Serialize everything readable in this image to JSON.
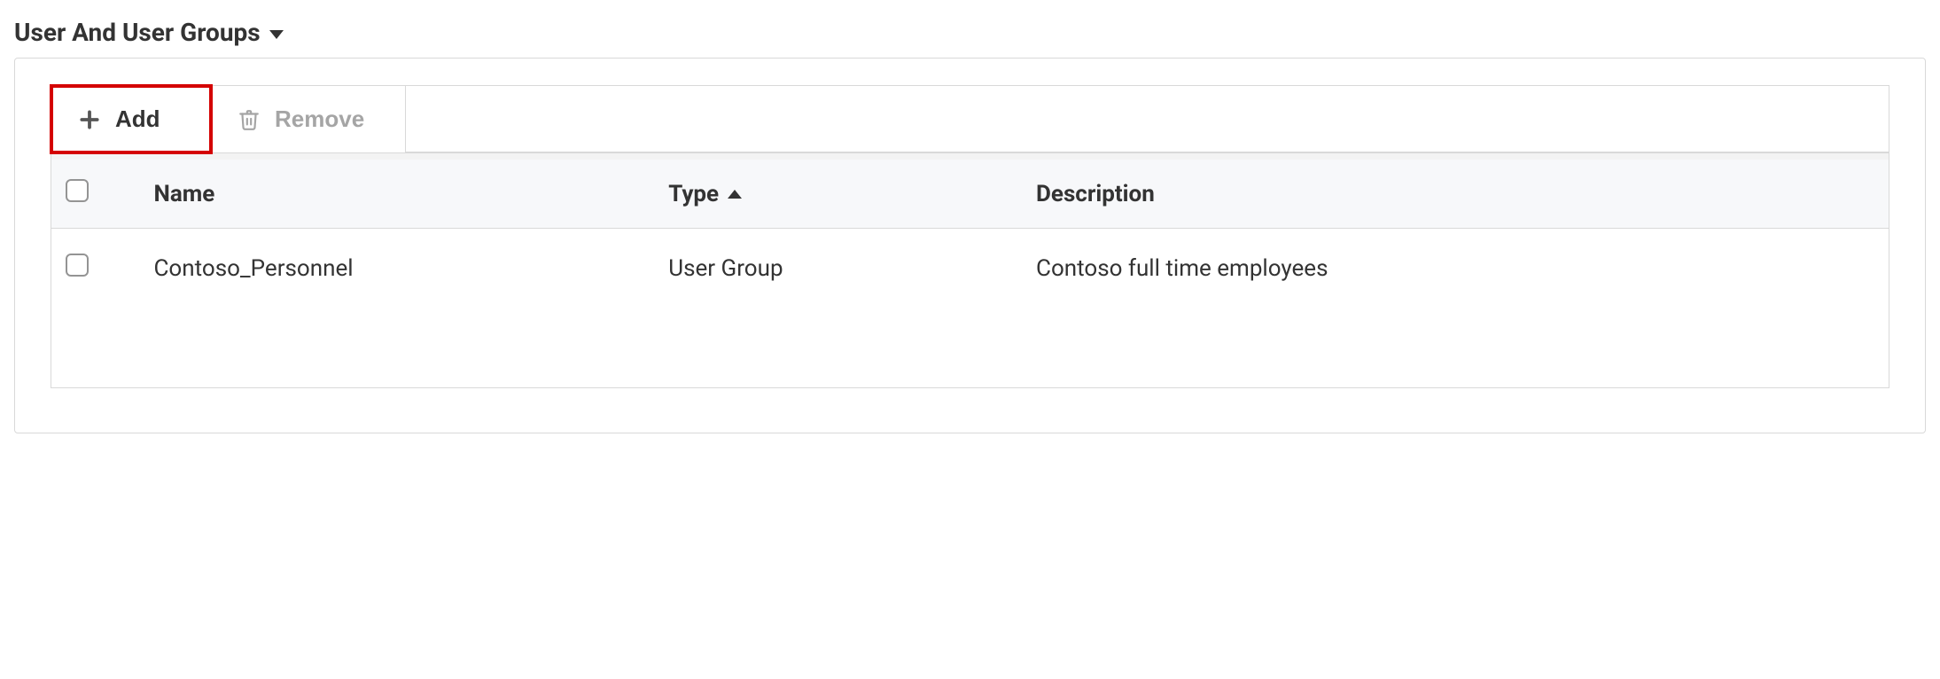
{
  "section": {
    "title": "User And User Groups"
  },
  "toolbar": {
    "add_label": "Add",
    "remove_label": "Remove"
  },
  "table": {
    "columns": {
      "name": "Name",
      "type": "Type",
      "description": "Description"
    },
    "rows": [
      {
        "name": "Contoso_Personnel",
        "type": "User Group",
        "description": "Contoso full time employees"
      }
    ]
  }
}
